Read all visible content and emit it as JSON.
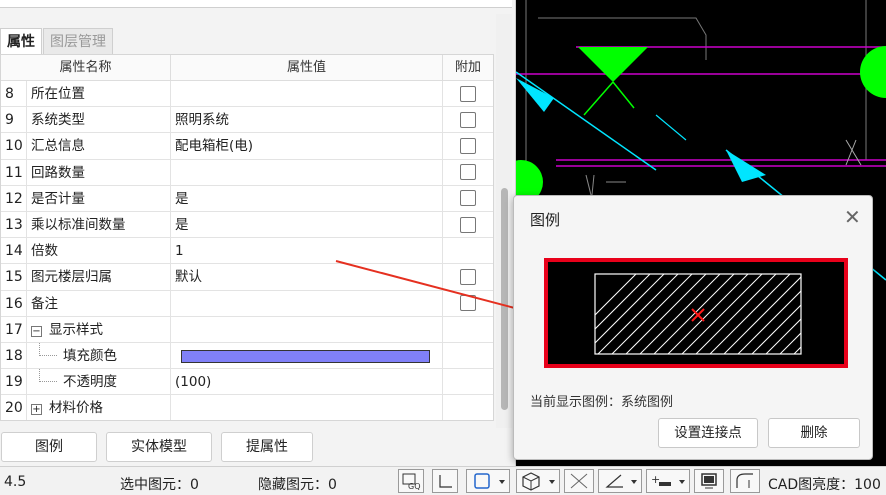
{
  "panel": {
    "tabs": [
      {
        "label": "属性",
        "active": true
      },
      {
        "label": "图层管理",
        "active": false
      }
    ],
    "columns": {
      "name": "属性名称",
      "value": "属性值",
      "add": "附加"
    },
    "rows": [
      {
        "num": "8",
        "name": "所在位置",
        "value": "",
        "has_checkbox": true
      },
      {
        "num": "9",
        "name": "系统类型",
        "value": "照明系统",
        "has_checkbox": true
      },
      {
        "num": "10",
        "name": "汇总信息",
        "value": "配电箱柜(电)",
        "has_checkbox": true
      },
      {
        "num": "11",
        "name": "回路数量",
        "value": "",
        "has_checkbox": true
      },
      {
        "num": "12",
        "name": "是否计量",
        "value": "是",
        "has_checkbox": true
      },
      {
        "num": "13",
        "name": "乘以标准间数量",
        "value": "是",
        "has_checkbox": true
      },
      {
        "num": "14",
        "name": "倍数",
        "value": "1",
        "has_checkbox": false
      },
      {
        "num": "15",
        "name": "图元楼层归属",
        "value": "默认",
        "has_checkbox": true
      },
      {
        "num": "16",
        "name": "备注",
        "value": "",
        "has_checkbox": true
      },
      {
        "num": "17",
        "name": "显示样式",
        "value": "",
        "has_checkbox": false,
        "toggle": "−"
      },
      {
        "num": "18",
        "name": "填充颜色",
        "value": "",
        "has_checkbox": false,
        "child": true,
        "color": "#8080f8"
      },
      {
        "num": "19",
        "name": "不透明度",
        "value": "(100)",
        "has_checkbox": false,
        "child": true
      },
      {
        "num": "20",
        "name": "材料价格",
        "value": "",
        "has_checkbox": false,
        "toggle": "+"
      }
    ],
    "buttons": {
      "legend": "图例",
      "solid_model": "实体模型",
      "extract": "提属性"
    }
  },
  "dialog": {
    "title": "图例",
    "current_legend": "当前显示图例：系统图例",
    "buttons": {
      "set_connection": "设置连接点",
      "delete": "删除"
    }
  },
  "status": {
    "coord": "4.5",
    "selected": "选中图元：0",
    "hidden": "隐藏图元：0",
    "cad_brightness": "CAD图亮度：100"
  },
  "colors": {
    "accent_green": "#00ff00",
    "cad_bg": "#000000",
    "highlight_red": "#e8001a",
    "fill_color": "#8080f8"
  }
}
